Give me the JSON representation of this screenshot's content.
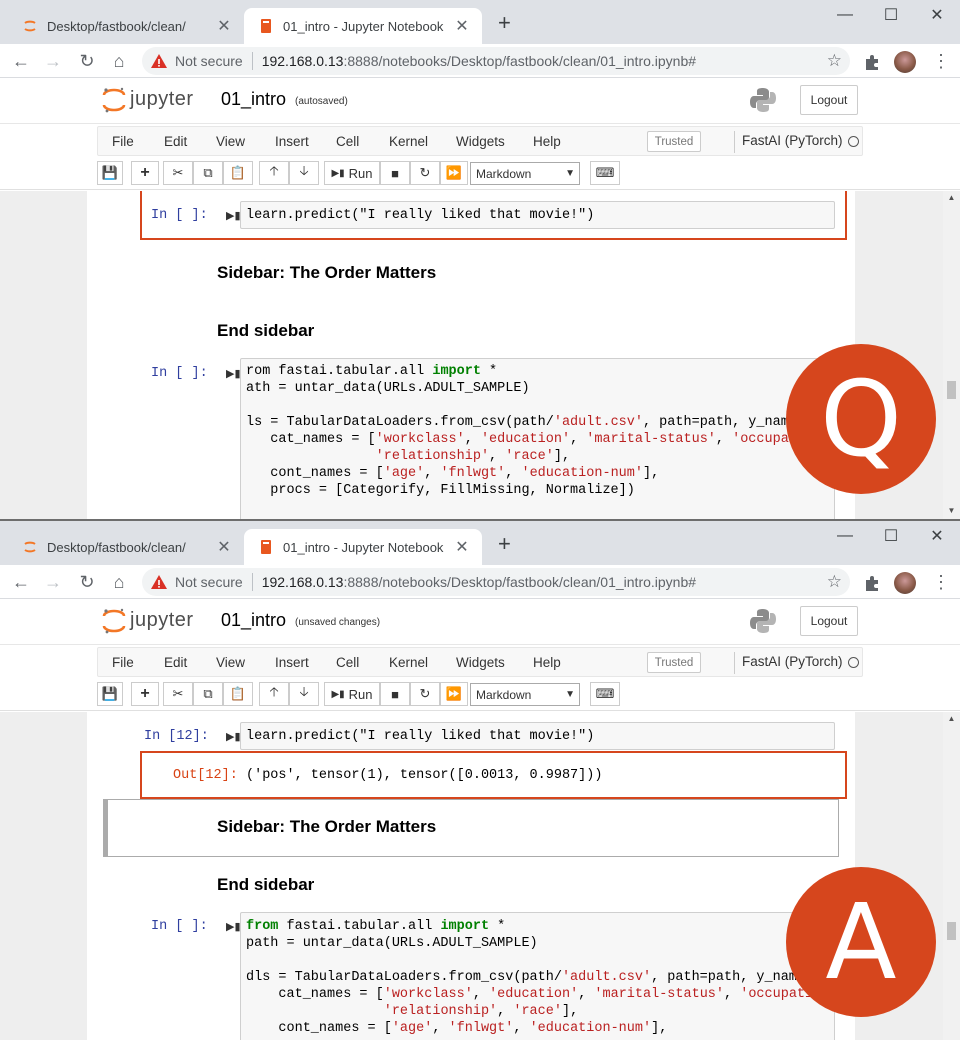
{
  "browser": {
    "tab_inactive_title": "Desktop/fastbook/clean/",
    "tab_active_title": "01_intro - Jupyter Notebook",
    "new_tab": "+",
    "minimize": "—",
    "maximize": "☐",
    "close": "✕",
    "tab_close": "✕",
    "not_secure": "Not secure",
    "url_host": "192.168.0.13",
    "url_rest": ":8888/notebooks/Desktop/fastbook/clean/01_intro.ipynb#",
    "star": "☆",
    "menu": "⋮"
  },
  "jupyter": {
    "wordmark": "jupyter",
    "notebook_name": "01_intro",
    "logout": "Logout",
    "menu": [
      "File",
      "Edit",
      "View",
      "Insert",
      "Cell",
      "Kernel",
      "Widgets",
      "Help"
    ],
    "trusted": "Trusted",
    "kernel": "FastAI (PyTorch)",
    "run": "Run",
    "cell_type": "Markdown"
  },
  "panels": {
    "top": {
      "save_status": "(autosaved)",
      "cell1_prompt": "In [ ]:",
      "cell1_code": "learn.predict(\"I really liked that movie!\")",
      "heading1": "Sidebar: The Order Matters",
      "heading2": "End sidebar",
      "cell2_prompt": "In [ ]:",
      "badge": "Q"
    },
    "bottom": {
      "save_status": "(unsaved changes)",
      "cell1_prompt": "In [12]:",
      "cell1_code": "learn.predict(\"I really liked that movie!\")",
      "out_prompt": "Out[12]:",
      "output": "('pos', tensor(1), tensor([0.0013, 0.9987]))",
      "heading1": "Sidebar: The Order Matters",
      "heading2": "End sidebar",
      "cell2_prompt": "In [ ]:",
      "badge": "A"
    }
  },
  "code_cell": {
    "top_lines": [
      "rom fastai.tabular.all import *",
      "ath = untar_data(URLs.ADULT_SAMPLE)",
      "",
      "ls = TabularDataLoaders.from_csv(path/'adult.csv', path=path, y_names=\"",
      "   cat_names = ['workclass', 'education', 'marital-status', 'occupation'",
      "                'relationship', 'race'],",
      "   cont_names = ['age', 'fnlwgt', 'education-num'],",
      "   procs = [Categorify, FillMissing, Normalize])"
    ],
    "bottom_lines": [
      "from fastai.tabular.all import *",
      "path = untar_data(URLs.ADULT_SAMPLE)",
      "",
      "dls = TabularDataLoaders.from_csv(path/'adult.csv', path=path, y_names=\"s",
      "    cat_names = ['workclass', 'education', 'marital-status', 'occupation',",
      "                 'relationship', 'race'],",
      "    cont_names = ['age', 'fnlwgt', 'education-num'],"
    ]
  },
  "colors": {
    "accent": "#d6461d",
    "prompt_in": "#303f9f",
    "prompt_out": "#d84315"
  }
}
